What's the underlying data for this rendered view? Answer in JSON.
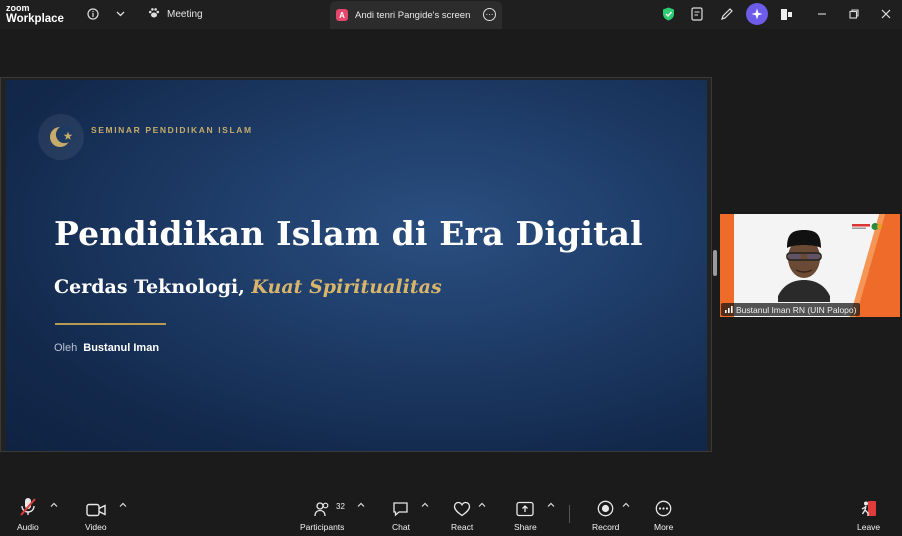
{
  "app": {
    "logo_line1": "zoom",
    "logo_line2": "Workplace"
  },
  "tabs": {
    "meeting": {
      "label": "Meeting",
      "icon": "paw-icon"
    },
    "screen_share": {
      "badge": "A",
      "label": "Andi tenri Pangide's screen",
      "badge_color": "#e4466c"
    }
  },
  "slide": {
    "overline": "SEMINAR PENDIDIKAN ISLAM",
    "title": "Pendidikan Islam di Era Digital",
    "subtitle_main": "Cerdas Teknologi, ",
    "subtitle_accent": "Kuat Spiritualitas",
    "byline_prefix": "Oleh",
    "author": "Bustanul Iman",
    "colors": {
      "background": "#1e3c68",
      "gold": "#c7ab6a",
      "accent_text": "#d8b56a"
    }
  },
  "video_tile": {
    "participant_name": "Bustanul Iman RN (UIN Palopo)",
    "accent_color": "#ee6b2a"
  },
  "toolbar": {
    "audio": "Audio",
    "video": "Video",
    "participants": "Participants",
    "participants_count": "32",
    "chat": "Chat",
    "react": "React",
    "share": "Share",
    "record": "Record",
    "more": "More",
    "leave": "Leave"
  },
  "status_colors": {
    "shield": "#2ecc71",
    "muted_mic": "#e23b3b",
    "leave": "#e23b3b"
  }
}
